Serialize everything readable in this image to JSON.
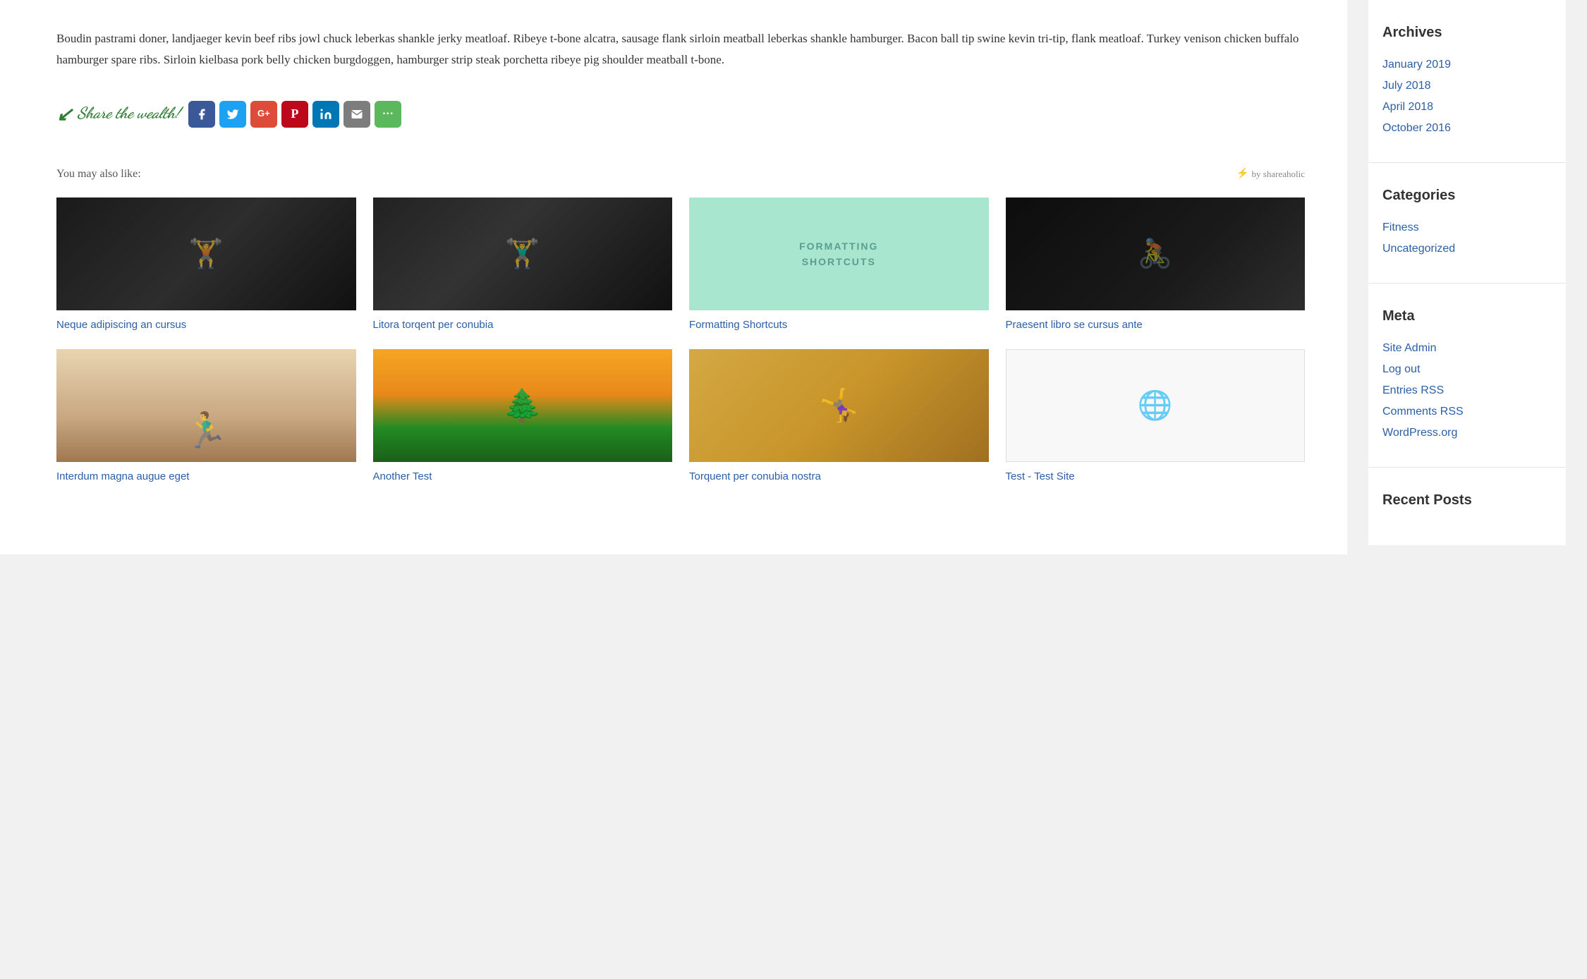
{
  "main": {
    "article": {
      "body": "Boudin pastrami doner, landjaeger kevin beef ribs jowl chuck leberkas shankle jerky meatloaf. Ribeye t-bone alcatra, sausage flank sirloin meatball leberkas shankle hamburger. Bacon ball tip swine kevin tri-tip, flank meatloaf. Turkey venison chicken buffalo hamburger spare ribs. Sirloin kielbasa pork belly chicken burgdoggen, hamburger strip steak porchetta ribeye pig shoulder meatball t-bone."
    },
    "share": {
      "label": "Share the wealth!",
      "icons": [
        {
          "name": "Facebook",
          "class": "fb",
          "symbol": "f"
        },
        {
          "name": "Twitter",
          "class": "tw",
          "symbol": "t"
        },
        {
          "name": "Google+",
          "class": "gp",
          "symbol": "G+"
        },
        {
          "name": "Pinterest",
          "class": "pt",
          "symbol": "P"
        },
        {
          "name": "LinkedIn",
          "class": "li",
          "symbol": "in"
        },
        {
          "name": "Email",
          "class": "em",
          "symbol": "✉"
        },
        {
          "name": "More",
          "class": "mo",
          "symbol": "…"
        }
      ]
    },
    "related": {
      "label": "You may also like:",
      "credit": "by shareaholic",
      "items": [
        {
          "title": "Neque adipiscing an cursus",
          "img_type": "gym-img-1",
          "url": "#"
        },
        {
          "title": "Litora torqent per conubia",
          "img_type": "gym-img-2",
          "url": "#"
        },
        {
          "title": "Formatting Shortcuts",
          "img_type": "formatting",
          "url": "#"
        },
        {
          "title": "Praesent libro se cursus ante",
          "img_type": "gym-img-dark",
          "url": "#"
        },
        {
          "title": "Interdum magna augue eget",
          "img_type": "man-sitting",
          "url": "#"
        },
        {
          "title": "Another Test",
          "img_type": "winter-img",
          "url": "#"
        },
        {
          "title": "Torquent per conubia nostra",
          "img_type": "two-people-img",
          "url": "#"
        },
        {
          "title": "Test - Test Site",
          "img_type": "website-img",
          "url": "#"
        }
      ]
    }
  },
  "sidebar": {
    "archives": {
      "heading": "Archives",
      "items": [
        {
          "label": "January 2019",
          "url": "#"
        },
        {
          "label": "July 2018",
          "url": "#"
        },
        {
          "label": "April 2018",
          "url": "#"
        },
        {
          "label": "October 2016",
          "url": "#"
        }
      ]
    },
    "categories": {
      "heading": "Categories",
      "items": [
        {
          "label": "Fitness",
          "url": "#"
        },
        {
          "label": "Uncategorized",
          "url": "#"
        }
      ]
    },
    "meta": {
      "heading": "Meta",
      "items": [
        {
          "label": "Site Admin",
          "url": "#"
        },
        {
          "label": "Log out",
          "url": "#"
        },
        {
          "label": "Entries RSS",
          "url": "#"
        },
        {
          "label": "Comments RSS",
          "url": "#"
        },
        {
          "label": "WordPress.org",
          "url": "#"
        }
      ]
    },
    "recent_posts": {
      "heading": "Recent Posts"
    }
  },
  "formatting_placeholder": {
    "line1": "FORMATTING",
    "line2": "SHORTCUTS"
  }
}
